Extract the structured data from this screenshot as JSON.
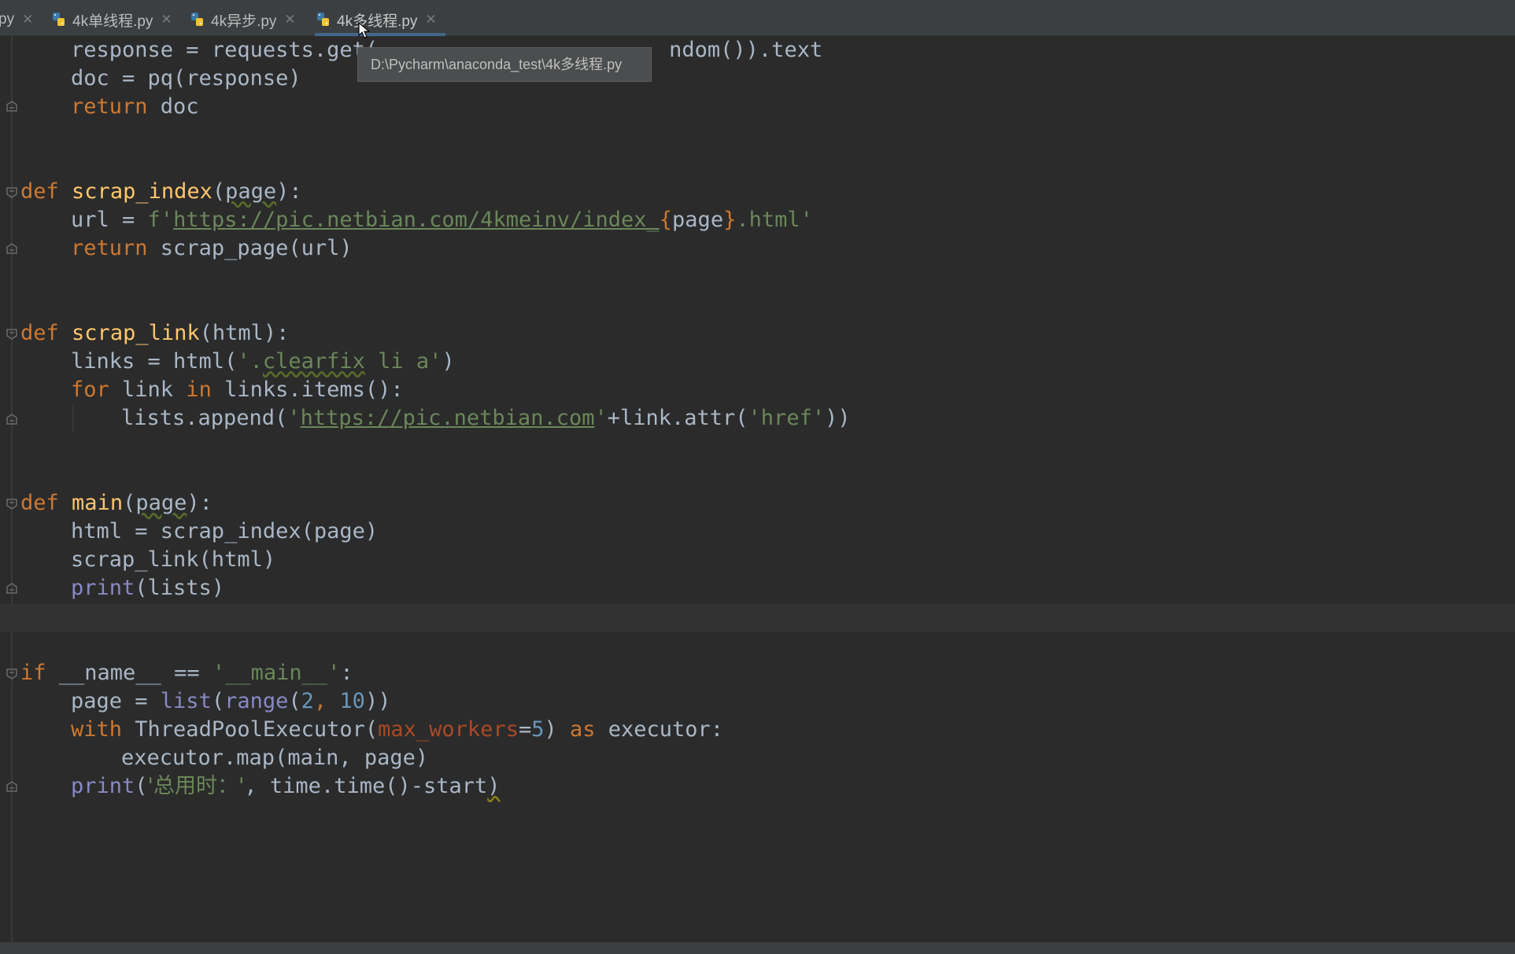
{
  "tabs": [
    {
      "label": "py",
      "active": false
    },
    {
      "label": "4k单线程.py",
      "active": false
    },
    {
      "label": "4k异步.py",
      "active": false
    },
    {
      "label": "4k多线程.py",
      "active": true
    }
  ],
  "tooltip": "D:\\Pycharm\\anaconda_test\\4k多线程.py",
  "colors": {
    "keyword": "#cc7832",
    "function": "#ffc66d",
    "string": "#6a8759",
    "number": "#6897bb",
    "builtin": "#8888c6",
    "background": "#2b2b2b"
  },
  "code": {
    "l1": {
      "a": "response = requests.get(",
      "b": "ndom()).text"
    },
    "l2": "doc = pq(response)",
    "l3": {
      "kw": "return",
      "rest": " doc"
    },
    "def1": {
      "kw": "def",
      "name": "scrap_index",
      "open": "(",
      "param": "page",
      "close": "):"
    },
    "url_line": {
      "a": "url = ",
      "fprefix": "f'",
      "url": "https://pic.netbian.com/4kmeinv/index_",
      "brace1": "{",
      "var": "page",
      "brace2": "}",
      "tail": ".html'"
    },
    "ret1": {
      "kw": "return",
      "rest": " scrap_page(url)"
    },
    "def2": {
      "kw": "def",
      "name": "scrap_link",
      "rest": "(html):"
    },
    "links_line": {
      "a": "links = html(",
      "s1": "'.",
      "s2": "clearfix",
      "s3": " li a'",
      "b": ")"
    },
    "for_line": {
      "kw1": "for",
      "a": " link ",
      "kw2": "in",
      "b": " links.items():"
    },
    "append_line": {
      "a": "lists.append(",
      "q": "'",
      "url": "https://pic.netbian.com",
      "q2": "'",
      "b": "+link.attr(",
      "s": "'href'",
      "c": "))"
    },
    "def3": {
      "kw": "def",
      "name": "main",
      "open": "(",
      "param": "page",
      "close": "):"
    },
    "html_line": "html = scrap_index(page)",
    "scrap_link_call": "scrap_link(html)",
    "print1": {
      "bi": "print",
      "rest": "(lists)"
    },
    "if_line": {
      "kw": "if",
      "a": " __name__ == ",
      "s": "'__main__'",
      "b": ":"
    },
    "page_line": {
      "a": "page = ",
      "bi1": "list",
      "b": "(",
      "bi2": "range",
      "c": "(",
      "n1": "2",
      "d": ", ",
      "n2": "10",
      "e": "))"
    },
    "with_line": {
      "kw1": "with",
      "a": " ThreadPoolExecutor(",
      "param": "max_workers",
      "b": "=",
      "n": "5",
      "c": ") ",
      "kw2": "as",
      "d": " executor:"
    },
    "map_line": "executor.map(main, page)",
    "print2": {
      "bi": "print",
      "a": "(",
      "s": "'总用时：'",
      "b": ", time.time()-start",
      "c": ")"
    }
  }
}
